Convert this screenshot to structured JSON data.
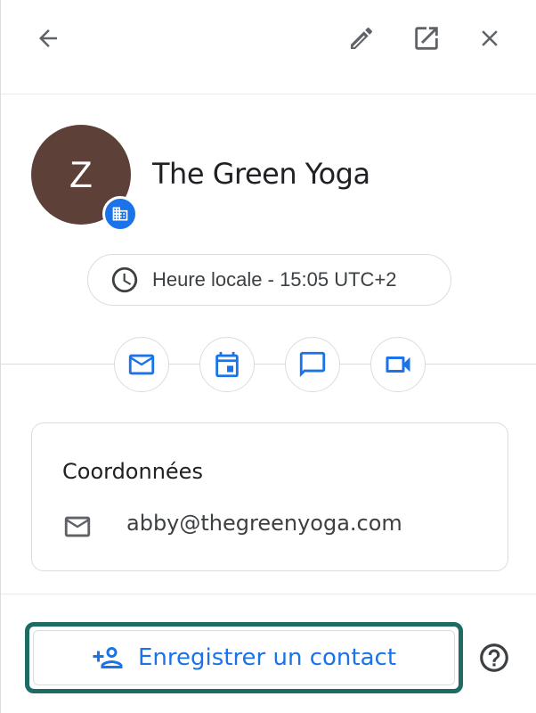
{
  "toolbar": {
    "back_icon": "arrow-left-icon",
    "edit_icon": "pencil-icon",
    "open_icon": "open-in-new-icon",
    "close_icon": "close-icon"
  },
  "contact": {
    "initial": "Z",
    "avatar_color": "#5d4037",
    "badge_icon": "building-icon",
    "name": "The Green Yoga",
    "local_time": "Heure locale - 15:05 UTC+2"
  },
  "actions": [
    {
      "icon": "email-icon"
    },
    {
      "icon": "calendar-icon"
    },
    {
      "icon": "chat-icon"
    },
    {
      "icon": "video-icon"
    }
  ],
  "details": {
    "title": "Coordonnées",
    "email": "abby@thegreenyoga.com"
  },
  "footer": {
    "save_label": "Enregistrer un contact",
    "help_icon": "help-icon"
  },
  "colors": {
    "accent": "#1a73e8",
    "highlight": "#1e6b64"
  }
}
